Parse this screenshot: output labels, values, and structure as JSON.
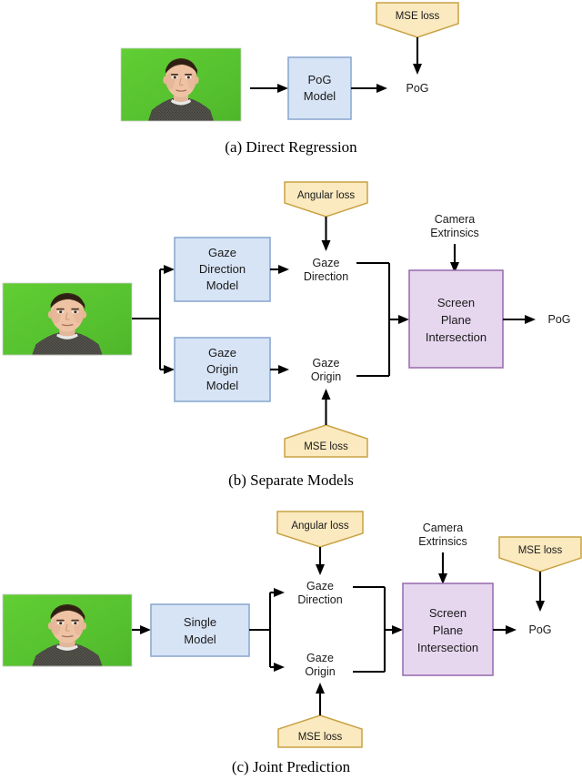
{
  "figure": {
    "title_semantics": "Three gaze estimation pipeline architectures",
    "panels": [
      {
        "id": "a",
        "caption": "(a) Direct Regression",
        "input_image": {
          "alt": "face-photo-green-screen",
          "background_color": "#5cc832"
        },
        "nodes": [
          {
            "name": "pog-model-box",
            "lines": [
              "PoG",
              "Model"
            ],
            "shape": "rect",
            "color": "#d7e4f6"
          },
          {
            "name": "pog-output-label",
            "lines": [
              "PoG"
            ],
            "shape": "text"
          },
          {
            "name": "mse-loss-banner",
            "lines": [
              "MSE loss"
            ],
            "shape": "banner-down",
            "color": "#fbe9bf"
          }
        ]
      },
      {
        "id": "b",
        "caption": "(b) Separate Models",
        "input_image": {
          "alt": "face-photo-green-screen",
          "background_color": "#5cc832"
        },
        "nodes": [
          {
            "name": "gaze-direction-model-box",
            "lines": [
              "Gaze",
              "Direction",
              "Model"
            ],
            "shape": "rect",
            "color": "#d7e4f6"
          },
          {
            "name": "gaze-origin-model-box",
            "lines": [
              "Gaze",
              "Origin",
              "Model"
            ],
            "shape": "rect",
            "color": "#d7e4f6"
          },
          {
            "name": "gaze-direction-label",
            "lines": [
              "Gaze",
              "Direction"
            ],
            "shape": "text"
          },
          {
            "name": "gaze-origin-label",
            "lines": [
              "Gaze",
              "Origin"
            ],
            "shape": "text"
          },
          {
            "name": "camera-extrinsics-label",
            "lines": [
              "Camera",
              "Extrinsics"
            ],
            "shape": "text"
          },
          {
            "name": "screen-plane-intersection-box",
            "lines": [
              "Screen",
              "Plane",
              "Intersection"
            ],
            "shape": "rect",
            "color": "#e6d7ef"
          },
          {
            "name": "pog-output-label",
            "lines": [
              "PoG"
            ],
            "shape": "text"
          },
          {
            "name": "angular-loss-banner",
            "lines": [
              "Angular loss"
            ],
            "shape": "banner-down",
            "color": "#fbe9bf"
          },
          {
            "name": "mse-loss-banner",
            "lines": [
              "MSE loss"
            ],
            "shape": "banner-up",
            "color": "#fbe9bf"
          }
        ]
      },
      {
        "id": "c",
        "caption": "(c) Joint Prediction",
        "input_image": {
          "alt": "face-photo-green-screen",
          "background_color": "#5cc832"
        },
        "nodes": [
          {
            "name": "single-model-box",
            "lines": [
              "Single",
              "Model"
            ],
            "shape": "rect",
            "color": "#d7e4f6"
          },
          {
            "name": "gaze-direction-label",
            "lines": [
              "Gaze",
              "Direction"
            ],
            "shape": "text"
          },
          {
            "name": "gaze-origin-label",
            "lines": [
              "Gaze",
              "Origin"
            ],
            "shape": "text"
          },
          {
            "name": "camera-extrinsics-label",
            "lines": [
              "Camera",
              "Extrinsics"
            ],
            "shape": "text"
          },
          {
            "name": "screen-plane-intersection-box",
            "lines": [
              "Screen",
              "Plane",
              "Intersection"
            ],
            "shape": "rect",
            "color": "#e6d7ef"
          },
          {
            "name": "pog-output-label",
            "lines": [
              "PoG"
            ],
            "shape": "text"
          },
          {
            "name": "angular-loss-banner",
            "lines": [
              "Angular loss"
            ],
            "shape": "banner-down",
            "color": "#fbe9bf"
          },
          {
            "name": "mse-loss-banner-top",
            "lines": [
              "MSE loss"
            ],
            "shape": "banner-down",
            "color": "#fbe9bf"
          },
          {
            "name": "mse-loss-banner-bottom",
            "lines": [
              "MSE loss"
            ],
            "shape": "banner-up",
            "color": "#fbe9bf"
          }
        ]
      }
    ]
  },
  "panel_a": {
    "caption": "(a) Direct Regression",
    "mse_loss": "MSE loss",
    "model_line1": "PoG",
    "model_line2": "Model",
    "pog": "PoG"
  },
  "panel_b": {
    "caption": "(b) Separate Models",
    "angular_loss": "Angular loss",
    "mse_loss": "MSE loss",
    "dir_model_line1": "Gaze",
    "dir_model_line2": "Direction",
    "dir_model_line3": "Model",
    "origin_model_line1": "Gaze",
    "origin_model_line2": "Origin",
    "origin_model_line3": "Model",
    "gaze_direction_line1": "Gaze",
    "gaze_direction_line2": "Direction",
    "gaze_origin_line1": "Gaze",
    "gaze_origin_line2": "Origin",
    "camera_line1": "Camera",
    "camera_line2": "Extrinsics",
    "screen_line1": "Screen",
    "screen_line2": "Plane",
    "screen_line3": "Intersection",
    "pog": "PoG"
  },
  "panel_c": {
    "caption": "(c) Joint Prediction",
    "angular_loss": "Angular loss",
    "mse_loss_top": "MSE loss",
    "mse_loss_bottom": "MSE loss",
    "model_line1": "Single",
    "model_line2": "Model",
    "gaze_direction_line1": "Gaze",
    "gaze_direction_line2": "Direction",
    "gaze_origin_line1": "Gaze",
    "gaze_origin_line2": "Origin",
    "camera_line1": "Camera",
    "camera_line2": "Extrinsics",
    "screen_line1": "Screen",
    "screen_line2": "Plane",
    "screen_line3": "Intersection",
    "pog": "PoG"
  },
  "colors": {
    "model_box_fill": "#d7e4f6",
    "model_box_stroke": "#8eaad0",
    "geometry_box_fill": "#e6d7ef",
    "geometry_box_stroke": "#9c6fb0",
    "loss_fill": "#fbe9bf",
    "loss_stroke": "#c8a243",
    "edge": "#000000",
    "green_screen": "#5cc832"
  }
}
